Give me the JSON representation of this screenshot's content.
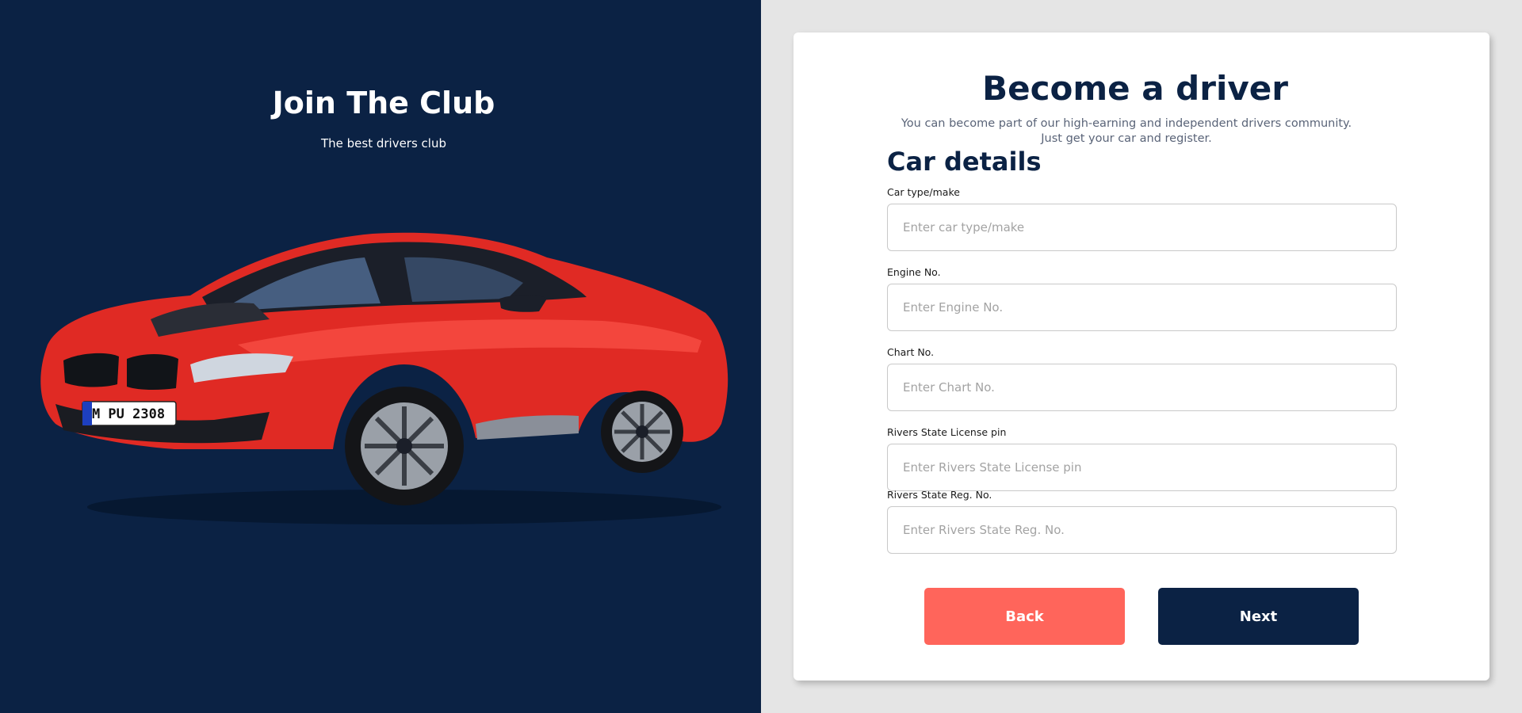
{
  "hero": {
    "title": "Join The Club",
    "subtitle": "The best drivers club",
    "plate_text": "M PU 2308"
  },
  "form": {
    "title": "Become a driver",
    "description_line1": "You can become part of our high-earning and independent drivers community.",
    "description_line2": "Just get your car and register.",
    "section_title": "Car details",
    "fields": [
      {
        "label": "Car type/make",
        "placeholder": "Enter car type/make",
        "value": ""
      },
      {
        "label": "Engine No.",
        "placeholder": "Enter Engine No.",
        "value": ""
      },
      {
        "label": "Chart No.",
        "placeholder": "Enter Chart No.",
        "value": ""
      },
      {
        "label": "Rivers State License pin",
        "placeholder": "Enter Rivers State License pin",
        "value": ""
      },
      {
        "label": "Rivers State Reg. No.",
        "placeholder": "Enter Rivers State Reg. No.",
        "value": ""
      }
    ],
    "back_label": "Back",
    "next_label": "Next"
  },
  "colors": {
    "navy": "#0b2244",
    "coral": "#ff655b",
    "car_red": "#e02a24",
    "page_bg": "#e5e5e5"
  }
}
